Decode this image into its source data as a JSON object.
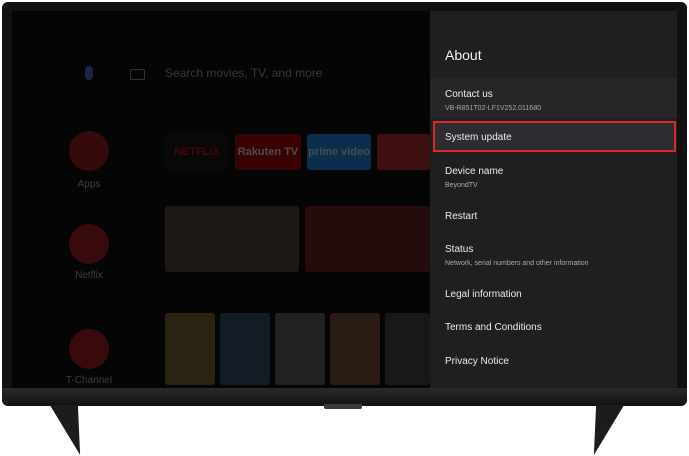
{
  "launcher": {
    "search_hint": "Search movies, TV, and more",
    "side_apps": [
      {
        "label": "Apps",
        "icon": "apps-grid-icon"
      },
      {
        "label": "Netflix",
        "icon": "netflix-logo"
      },
      {
        "label": "T-Channel",
        "icon": "tchannel-logo"
      }
    ],
    "app_row": [
      "NETFLIX",
      "Rakuten TV",
      "prime video",
      ""
    ]
  },
  "panel": {
    "title": "About",
    "items": [
      {
        "label": "Contact us",
        "sub": "VB-R851T02-LF1V252.011680"
      },
      {
        "label": "System update",
        "sub": ""
      },
      {
        "label": "Device name",
        "sub": "BeyondTV"
      },
      {
        "label": "Restart",
        "sub": ""
      },
      {
        "label": "Status",
        "sub": "Network, serial numbers and other information"
      },
      {
        "label": "Legal information",
        "sub": ""
      },
      {
        "label": "Terms and Conditions",
        "sub": ""
      },
      {
        "label": "Privacy Notice",
        "sub": ""
      }
    ],
    "selected_item": "System update"
  },
  "colors": {
    "panel_bg": "#1e1f21",
    "highlight_border": "#e0262b",
    "netflix_red": "#c0171b"
  }
}
